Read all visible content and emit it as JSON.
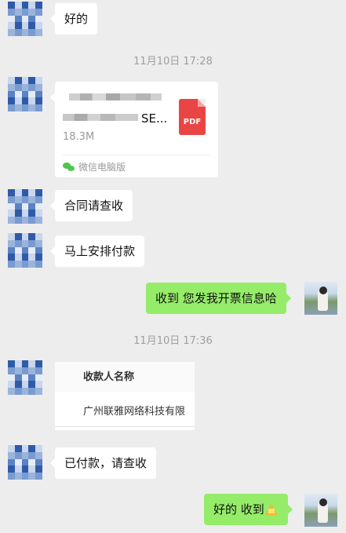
{
  "chat": {
    "msg1": "好的",
    "time1": "11月10日 17:28",
    "file": {
      "name_visible": "SE...",
      "size": "18.3M",
      "type": "PDF",
      "source": "微信电脑版"
    },
    "msg2": "合同请查收",
    "msg3": "马上安排付款",
    "msg4": "收到 您发我开票信息哈",
    "time2": "11月10日 17:36",
    "image_card": {
      "header": "收款人名称",
      "value": "广州联雅网络科技有限"
    },
    "msg5": "已付款，请查收",
    "msg6": "好的 收到"
  },
  "colors": {
    "background": "#ededed",
    "incoming_bubble": "#ffffff",
    "outgoing_bubble": "#95ec69",
    "pdf_icon": "#e94545"
  },
  "icons": {
    "file": "pdf-file-icon",
    "source": "wechat-icon",
    "emoji": "pray-emoji-icon"
  }
}
